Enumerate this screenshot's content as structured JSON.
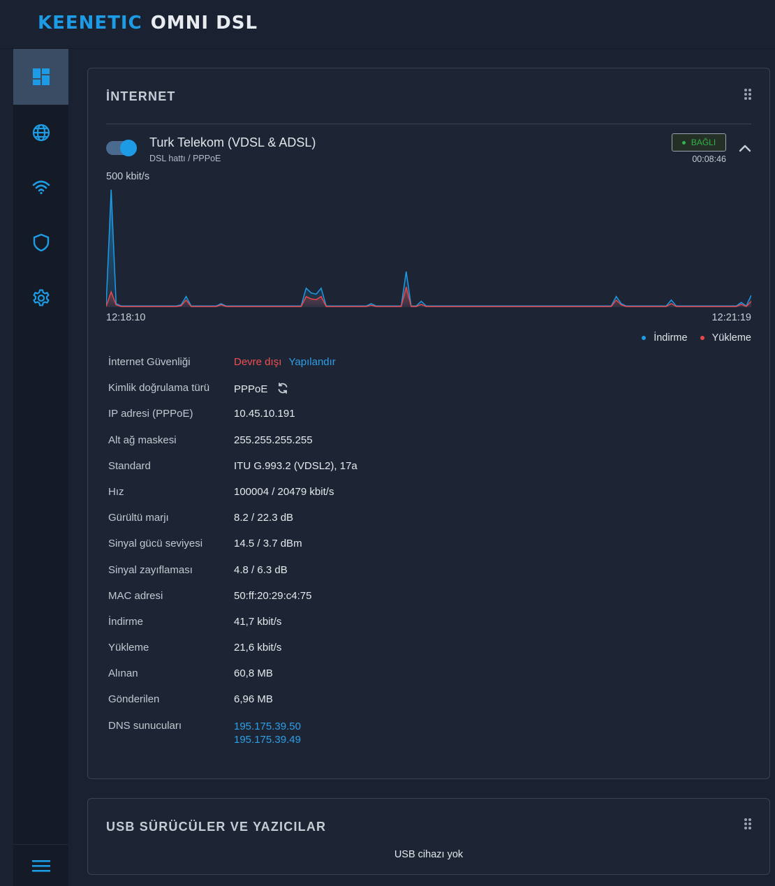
{
  "header": {
    "brand": "KEENETIC",
    "model": "OMNI DSL"
  },
  "sidebar": {
    "items": [
      {
        "name": "dashboard",
        "icon": "dashboard-icon",
        "active": true
      },
      {
        "name": "internet",
        "icon": "globe-icon",
        "active": false
      },
      {
        "name": "wifi",
        "icon": "wifi-icon",
        "active": false
      },
      {
        "name": "security",
        "icon": "shield-icon",
        "active": false
      },
      {
        "name": "settings",
        "icon": "gear-icon",
        "active": false
      }
    ],
    "menu_icon": "hamburger-icon"
  },
  "internet_card": {
    "title": "İNTERNET",
    "connection": {
      "name": "Turk Telekom (VDSL & ADSL)",
      "subtitle": "DSL hattı / PPPoE",
      "enabled": true,
      "status": "BAĞLI",
      "uptime": "00:08:46"
    },
    "chart_data": {
      "type": "area",
      "y_max_label": "500 kbit/s",
      "x_start_label": "12:18:10",
      "x_end_label": "12:21:19",
      "x_start": "12:18:10",
      "x_end": "12:21:19",
      "ylim": [
        0,
        500
      ],
      "series": [
        {
          "name": "İndirme",
          "color": "#1e9be5",
          "values": [
            5,
            495,
            15,
            5,
            5,
            5,
            5,
            5,
            5,
            5,
            5,
            5,
            5,
            5,
            5,
            10,
            45,
            5,
            5,
            5,
            5,
            5,
            5,
            15,
            5,
            5,
            5,
            5,
            5,
            5,
            5,
            5,
            5,
            5,
            5,
            5,
            5,
            5,
            5,
            5,
            80,
            60,
            55,
            80,
            5,
            5,
            5,
            5,
            5,
            5,
            5,
            5,
            5,
            15,
            5,
            5,
            5,
            5,
            5,
            5,
            150,
            5,
            5,
            25,
            5,
            5,
            5,
            5,
            5,
            5,
            5,
            5,
            5,
            5,
            5,
            5,
            5,
            5,
            5,
            5,
            5,
            5,
            5,
            5,
            5,
            5,
            5,
            5,
            5,
            5,
            5,
            5,
            5,
            5,
            5,
            5,
            5,
            5,
            5,
            5,
            5,
            5,
            45,
            15,
            5,
            5,
            5,
            5,
            5,
            5,
            5,
            5,
            5,
            30,
            5,
            5,
            5,
            5,
            5,
            5,
            5,
            5,
            5,
            5,
            5,
            5,
            5,
            20,
            5,
            50
          ]
        },
        {
          "name": "Yükleme",
          "color": "#e8484a",
          "values": [
            3,
            65,
            10,
            3,
            3,
            3,
            3,
            3,
            3,
            3,
            3,
            3,
            3,
            3,
            3,
            6,
            30,
            3,
            3,
            3,
            3,
            3,
            3,
            10,
            3,
            3,
            3,
            3,
            3,
            3,
            3,
            3,
            3,
            3,
            3,
            3,
            3,
            3,
            3,
            3,
            45,
            35,
            32,
            45,
            3,
            3,
            3,
            3,
            3,
            3,
            3,
            3,
            3,
            8,
            3,
            3,
            3,
            3,
            3,
            3,
            85,
            3,
            3,
            12,
            3,
            3,
            3,
            3,
            3,
            3,
            3,
            3,
            3,
            3,
            3,
            3,
            3,
            3,
            3,
            3,
            3,
            3,
            3,
            3,
            3,
            3,
            3,
            3,
            3,
            3,
            3,
            3,
            3,
            3,
            3,
            3,
            3,
            3,
            3,
            3,
            3,
            3,
            30,
            10,
            3,
            3,
            3,
            3,
            3,
            3,
            3,
            3,
            3,
            15,
            3,
            3,
            3,
            3,
            3,
            3,
            3,
            3,
            3,
            3,
            3,
            3,
            3,
            12,
            3,
            25
          ]
        }
      ],
      "legend_position": "bottom-right",
      "grid": false
    },
    "legend": {
      "download": "İndirme",
      "upload": "Yükleme"
    },
    "info": {
      "security_label": "İnternet Güvenliği",
      "security_value": "Devre dışı",
      "security_link": "Yapılandır",
      "auth_label": "Kimlik doğrulama türü",
      "auth_value": "PPPoE",
      "ip_label": "IP adresi (PPPoE)",
      "ip_value": "10.45.10.191",
      "mask_label": "Alt ağ maskesi",
      "mask_value": "255.255.255.255",
      "standard_label": "Standard",
      "standard_value": "ITU G.993.2 (VDSL2), 17a",
      "speed_label": "Hız",
      "speed_value": "100004 / 20479 kbit/s",
      "noise_label": "Gürültü marjı",
      "noise_value": "8.2 / 22.3 dB",
      "signal_label": "Sinyal gücü seviyesi",
      "signal_value": "14.5 / 3.7 dBm",
      "attenuation_label": "Sinyal zayıflaması",
      "attenuation_value": "4.8 / 6.3 dB",
      "mac_label": "MAC adresi",
      "mac_value": "50:ff:20:29:c4:75",
      "download_label": "İndirme",
      "download_value": "41,7 kbit/s",
      "upload_label": "Yükleme",
      "upload_value": "21,6 kbit/s",
      "received_label": "Alınan",
      "received_value": "60,8 MB",
      "sent_label": "Gönderilen",
      "sent_value": "6,96 MB",
      "dns_label": "DNS sunucuları",
      "dns_1": "195.175.39.50",
      "dns_2": "195.175.39.49"
    }
  },
  "usb_card": {
    "title": "USB SÜRÜCÜLER VE YAZICILAR",
    "empty_text": "USB cihazı yok"
  },
  "colors": {
    "accent": "#1e9be5",
    "upload": "#e8484a",
    "status_ok": "#2fb34a",
    "disabled_red": "#ef4f4f",
    "background": "#1a2130",
    "card": "#1d2534"
  }
}
